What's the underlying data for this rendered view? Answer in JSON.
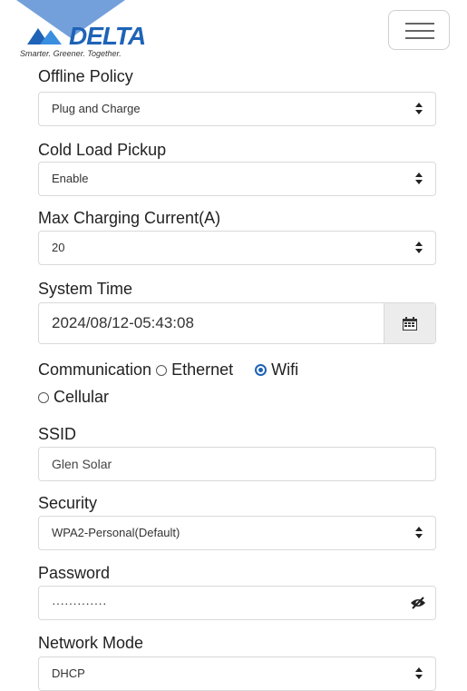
{
  "header": {
    "brand": "DELTA",
    "tagline": "Smarter. Greener. Together.",
    "menu_icon": "hamburger-icon"
  },
  "form": {
    "offline_policy": {
      "label": "Offline Policy",
      "value": "Plug and Charge"
    },
    "cold_load_pickup": {
      "label": "Cold Load Pickup",
      "value": "Enable"
    },
    "max_current": {
      "label": "Max Charging Current(A)",
      "value": "20"
    },
    "system_time": {
      "label": "System Time",
      "value": "2024/08/12-05:43:08",
      "icon": "calendar-icon"
    },
    "communication": {
      "label": "Communication",
      "options": [
        "Ethernet",
        "Wifi",
        "Cellular"
      ],
      "selected": "Wifi"
    },
    "ssid": {
      "label": "SSID",
      "value": "Glen Solar"
    },
    "security": {
      "label": "Security",
      "value": "WPA2-Personal(Default)"
    },
    "password": {
      "label": "Password",
      "value": "·············",
      "icon": "eye-slash-icon"
    },
    "network_mode": {
      "label": "Network Mode",
      "value": "DHCP"
    }
  },
  "colors": {
    "accent": "#1e63b7",
    "border": "#d9d9d9"
  }
}
